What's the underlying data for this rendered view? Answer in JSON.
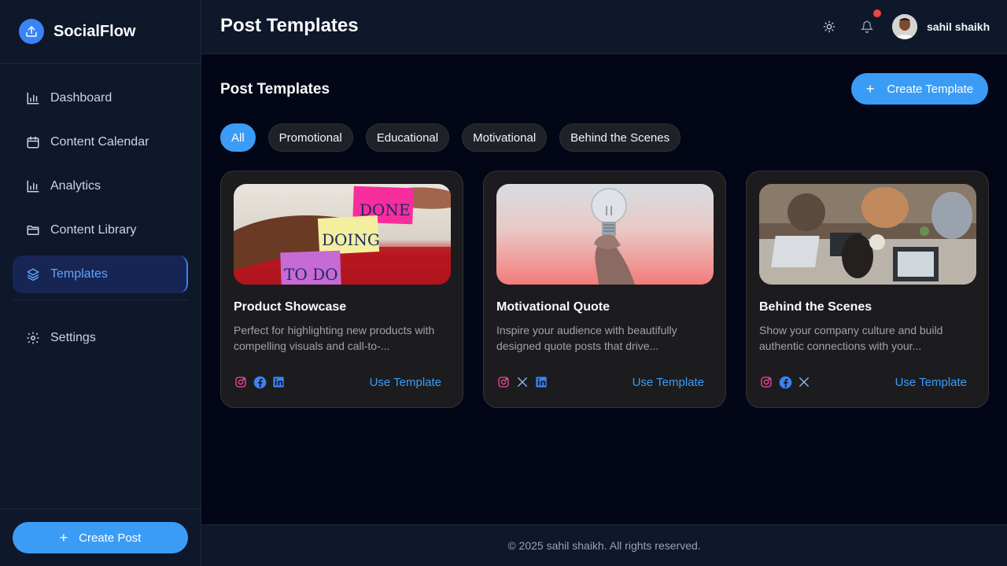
{
  "brand": {
    "name": "SocialFlow",
    "icon": "upload-icon",
    "accent": "#3b82f6"
  },
  "sidebar": {
    "items": [
      {
        "label": "Dashboard",
        "icon": "bar-chart-icon",
        "active": false
      },
      {
        "label": "Content Calendar",
        "icon": "calendar-icon",
        "active": false
      },
      {
        "label": "Analytics",
        "icon": "bar-chart-icon",
        "active": false
      },
      {
        "label": "Content Library",
        "icon": "folder-icon",
        "active": false
      },
      {
        "label": "Templates",
        "icon": "layers-icon",
        "active": true
      }
    ],
    "settings_label": "Settings",
    "create_post_label": "Create Post"
  },
  "header": {
    "title": "Post Templates",
    "user_name": "sahil shaikh",
    "has_notification": true
  },
  "main": {
    "section_title": "Post Templates",
    "create_template_label": "Create Template",
    "filters": [
      "All",
      "Promotional",
      "Educational",
      "Motivational",
      "Behind the Scenes"
    ],
    "active_filter": "All",
    "cards": [
      {
        "title": "Product Showcase",
        "description": "Perfect for highlighting new products with compelling visuals and call-to-...",
        "image_notes": [
          "DONE",
          "DOING",
          "TO DO"
        ],
        "platforms": [
          "instagram-icon",
          "facebook-icon",
          "linkedin-icon"
        ],
        "action": "Use Template"
      },
      {
        "title": "Motivational Quote",
        "description": "Inspire your audience with beautifully designed quote posts that drive...",
        "platforms": [
          "instagram-icon",
          "x-icon",
          "linkedin-icon"
        ],
        "action": "Use Template"
      },
      {
        "title": "Behind the Scenes",
        "description": "Show your company culture and build authentic connections with your...",
        "platforms": [
          "instagram-icon",
          "facebook-icon",
          "x-icon"
        ],
        "action": "Use Template"
      }
    ]
  },
  "footer": {
    "text": "© 2025 sahil shaikh. All rights reserved."
  }
}
